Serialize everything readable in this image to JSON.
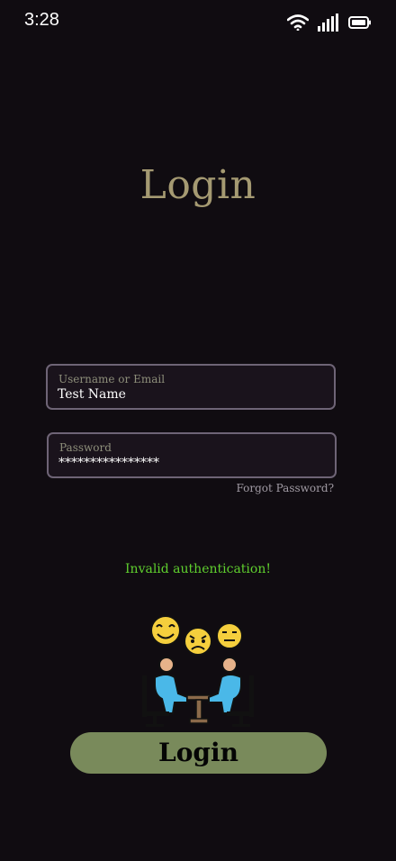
{
  "status_bar": {
    "time": "3:28",
    "icons": [
      "wifi-icon",
      "signal-icon",
      "battery-icon"
    ]
  },
  "title": "Login",
  "form": {
    "username_label": "Username or Email",
    "username_value": "Test Name",
    "password_label": "Password",
    "password_value": "****************",
    "forgot_password": "Forgot Password?",
    "error": "Invalid authentication!",
    "submit_label": "Login"
  },
  "illustration": {
    "icon": "people-meeting-emotions-icon"
  },
  "colors": {
    "background": "#100c11",
    "title": "#a59a72",
    "field_border": "#6e6476",
    "error": "#5fcf2e",
    "button": "#798a5b"
  }
}
